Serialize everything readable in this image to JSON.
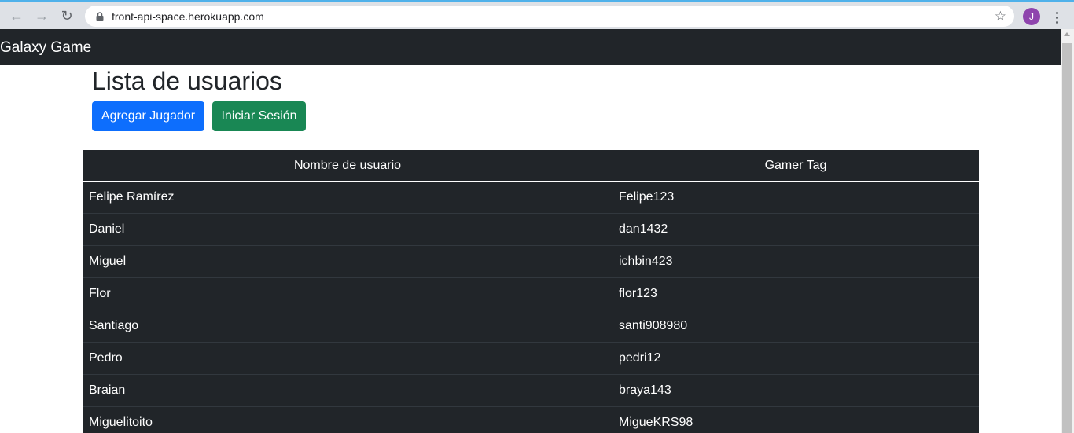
{
  "browser": {
    "url": "front-api-space.herokuapp.com",
    "profile_initial": "J"
  },
  "navbar": {
    "brand": "Galaxy Game"
  },
  "page": {
    "title": "Lista de usuarios",
    "add_player_label": "Agregar Jugador",
    "login_label": "Iniciar Sesión"
  },
  "colors": {
    "navbar_bg": "#212529",
    "primary": "#0d6efd",
    "success": "#198754"
  },
  "table": {
    "headers": [
      "Nombre de usuario",
      "Gamer Tag"
    ],
    "rows": [
      {
        "name": "Felipe Ramírez",
        "tag": "Felipe123"
      },
      {
        "name": "Daniel",
        "tag": "dan1432"
      },
      {
        "name": "Miguel",
        "tag": "ichbin423"
      },
      {
        "name": "Flor",
        "tag": "flor123"
      },
      {
        "name": "Santiago",
        "tag": "santi908980"
      },
      {
        "name": "Pedro",
        "tag": "pedri12"
      },
      {
        "name": "Braian",
        "tag": "braya143"
      },
      {
        "name": "Miguelitoito",
        "tag": "MigueKRS98"
      }
    ]
  }
}
